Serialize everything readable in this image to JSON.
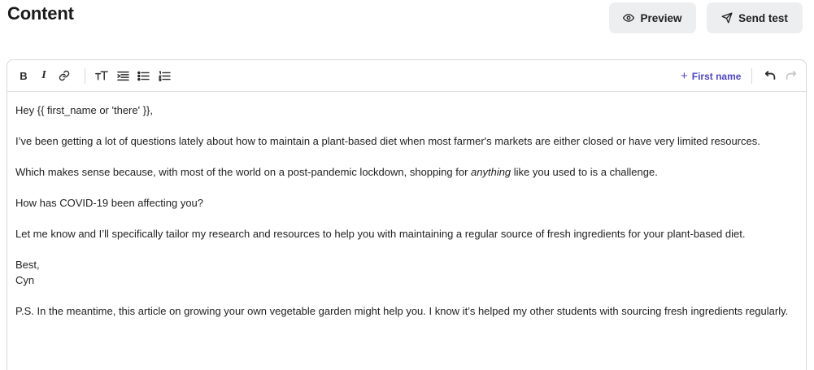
{
  "header": {
    "title": "Content",
    "preview_label": "Preview",
    "send_test_label": "Send test"
  },
  "toolbar": {
    "icons": [
      "bold-icon",
      "italic-icon",
      "link-icon",
      "text-size-icon",
      "text-indent-icon",
      "bulleted-list-icon",
      "numbered-list-icon",
      "undo-icon",
      "redo-icon"
    ],
    "bold_glyph": "B",
    "italic_glyph": "I",
    "merge_field_label": "First name",
    "merge_field_plus": "+"
  },
  "body": {
    "greeting": "Hey {{ first_name or 'there' }},",
    "para1": "I’ve been getting a lot of questions lately about how to maintain a plant-based diet when most farmer's markets are either closed or have very limited resources.",
    "para2_before": "Which makes sense because, with most of the world on a post-pandemic lockdown, shopping for ",
    "para2_emphasis": "anything",
    "para2_after": " like you used to is a challenge.",
    "para3": "How has COVID-19 been affecting you?",
    "para4": "Let me know and I’ll specifically tailor my research and resources to help you with maintaining a regular source of fresh ingredients for your plant-based diet.",
    "signoff": "Best,",
    "signature": "Cyn",
    "postscript": "P.S. In the meantime, this article on growing your own vegetable garden might help you. I know it’s helped my other students with sourcing fresh ingredients regularly."
  },
  "colors": {
    "accent": "#4f46c9",
    "button_bg": "#eceef0",
    "border": "#d5d7da"
  }
}
